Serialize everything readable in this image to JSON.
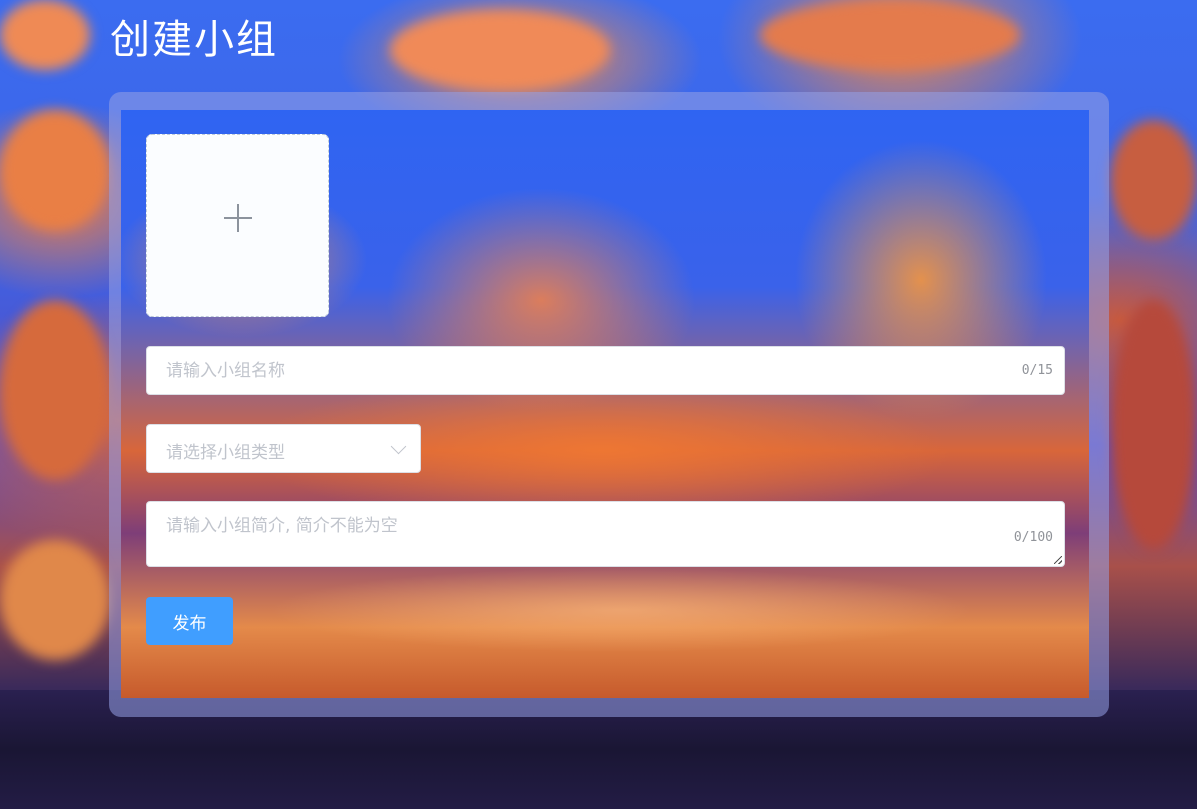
{
  "page": {
    "title": "创建小组"
  },
  "form": {
    "upload": {
      "icon": "plus-icon"
    },
    "group_name": {
      "placeholder": "请输入小组名称",
      "value": "",
      "counter": "0/15"
    },
    "group_type": {
      "placeholder": "请选择小组类型",
      "icon": "chevron-down-icon"
    },
    "intro": {
      "placeholder": "请输入小组简介, 简介不能为空",
      "value": "",
      "counter": "0/100"
    },
    "publish_label": "发布"
  },
  "colors": {
    "primary": "#409eff",
    "placeholder": "#c0c4cc",
    "border": "#dcdfe6"
  }
}
